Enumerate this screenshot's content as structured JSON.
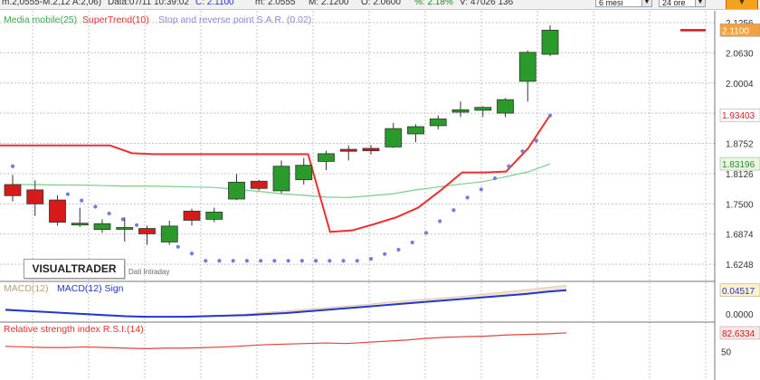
{
  "header": {
    "quote": "m.2,0555-M.2,12 A:2,06)",
    "data_label": "Data:07/11 10:39:02",
    "close_label": "C: 2.1100",
    "min_label": "m: 2.0555",
    "max_label": "M: 2.1200",
    "open_label": "O: 2.0600",
    "pct_label": "%: 2.18%",
    "volume_label": "V: 47026 136",
    "period_select": "6 mesi",
    "interval_select": "24 ore"
  },
  "logo": {
    "text": "VISUALTRADER",
    "subtitle": "Dati Intraday"
  },
  "colors": {
    "up": "#2a9a2a",
    "down": "#d61a1a",
    "supertrend": "#ee3030",
    "sar": "#7a7ad8",
    "ma": "#7ccd8a",
    "macd_line": "#2236d6",
    "macd_area": "#f1e4d2",
    "rsi": "#e84040",
    "grid": "#c4c4c4",
    "tag_price": "#f6a13d"
  },
  "chart_data": [
    {
      "type": "candlestick",
      "legend": [
        "Media mobile(25)",
        "SuperTrend(10)",
        "Stop and reverse point S.A.R. (0.02)"
      ],
      "ylim": [
        1.595,
        2.15
      ],
      "y_ticks": [
        "2.1256",
        "2.0630",
        "2.0004",
        "1.9378",
        "1.8752",
        "1.8126",
        "1.7500",
        "1.6874",
        "1.6248"
      ],
      "y_tick_values": [
        2.1256,
        2.063,
        2.0004,
        1.9378,
        1.8752,
        1.8126,
        1.75,
        1.6874,
        1.6248
      ],
      "candles": [
        {
          "o": 1.79,
          "h": 1.81,
          "l": 1.755,
          "c": 1.767
        },
        {
          "o": 1.779,
          "h": 1.799,
          "l": 1.725,
          "c": 1.75
        },
        {
          "o": 1.758,
          "h": 1.768,
          "l": 1.705,
          "c": 1.712
        },
        {
          "o": 1.707,
          "h": 1.742,
          "l": 1.702,
          "c": 1.71
        },
        {
          "o": 1.697,
          "h": 1.718,
          "l": 1.69,
          "c": 1.709
        },
        {
          "o": 1.699,
          "h": 1.722,
          "l": 1.672,
          "c": 1.701
        },
        {
          "o": 1.699,
          "h": 1.705,
          "l": 1.665,
          "c": 1.688
        },
        {
          "o": 1.671,
          "h": 1.715,
          "l": 1.665,
          "c": 1.704
        },
        {
          "o": 1.735,
          "h": 1.74,
          "l": 1.705,
          "c": 1.716
        },
        {
          "o": 1.718,
          "h": 1.742,
          "l": 1.712,
          "c": 1.733
        },
        {
          "o": 1.76,
          "h": 1.812,
          "l": 1.758,
          "c": 1.795
        },
        {
          "o": 1.797,
          "h": 1.8,
          "l": 1.778,
          "c": 1.782
        },
        {
          "o": 1.777,
          "h": 1.84,
          "l": 1.772,
          "c": 1.828
        },
        {
          "o": 1.8,
          "h": 1.845,
          "l": 1.79,
          "c": 1.83
        },
        {
          "o": 1.838,
          "h": 1.86,
          "l": 1.82,
          "c": 1.854
        },
        {
          "o": 1.863,
          "h": 1.871,
          "l": 1.84,
          "c": 1.859
        },
        {
          "o": 1.865,
          "h": 1.872,
          "l": 1.852,
          "c": 1.86
        },
        {
          "o": 1.868,
          "h": 1.918,
          "l": 1.866,
          "c": 1.906
        },
        {
          "o": 1.895,
          "h": 1.915,
          "l": 1.878,
          "c": 1.91
        },
        {
          "o": 1.912,
          "h": 1.933,
          "l": 1.904,
          "c": 1.926
        },
        {
          "o": 1.94,
          "h": 1.962,
          "l": 1.93,
          "c": 1.945
        },
        {
          "o": 1.944,
          "h": 1.952,
          "l": 1.93,
          "c": 1.95
        },
        {
          "o": 1.938,
          "h": 1.969,
          "l": 1.93,
          "c": 1.966
        },
        {
          "o": 2.004,
          "h": 2.068,
          "l": 1.962,
          "c": 2.064
        },
        {
          "o": 2.06,
          "h": 2.12,
          "l": 2.056,
          "c": 2.11
        }
      ],
      "supertrend": [
        1.871,
        1.871,
        1.871,
        1.871,
        1.871,
        1.871,
        1.855,
        1.853,
        1.853,
        1.853,
        1.853,
        1.853,
        1.853,
        1.853,
        1.853,
        1.692,
        1.695,
        1.708,
        1.722,
        1.742,
        1.777,
        1.815,
        1.815,
        1.817,
        1.865,
        1.934
      ],
      "sar": [
        1.828,
        1.806,
        1.791,
        1.78,
        1.77,
        1.757,
        1.744,
        1.73,
        1.718,
        1.706,
        1.692,
        1.676,
        1.661,
        1.647,
        1.632,
        1.632,
        1.632,
        1.632,
        1.632,
        1.632,
        1.632,
        1.632,
        1.632,
        1.632,
        1.632,
        1.632,
        1.636,
        1.646,
        1.655,
        1.67,
        1.69,
        1.714,
        1.737,
        1.763,
        1.78,
        1.803,
        1.828,
        1.859,
        1.881,
        1.933
      ],
      "sar_visible": [
        true,
        false,
        false,
        false,
        true,
        true,
        true,
        true,
        true,
        true,
        false,
        true,
        true,
        true,
        true,
        true,
        true,
        true,
        true,
        true,
        true,
        true,
        true,
        true,
        true,
        true,
        true,
        true,
        true,
        true,
        true,
        true,
        true,
        true,
        true,
        true,
        true,
        true,
        true,
        true
      ],
      "ma": [
        1.79,
        1.79,
        1.789,
        1.789,
        1.788,
        1.787,
        1.787,
        1.786,
        1.785,
        1.784,
        1.78,
        1.776,
        1.771,
        1.768,
        1.764,
        1.763,
        1.767,
        1.771,
        1.779,
        1.785,
        1.791,
        1.796,
        1.806,
        1.816,
        1.833
      ],
      "last_price_tag": "2.1100",
      "supertrend_tag": "1.93403",
      "ma_tag": "1.83196"
    },
    {
      "type": "line",
      "legend": [
        "MACD(12)",
        "MACD(12) Sign"
      ],
      "ylim": [
        -0.01,
        0.06
      ],
      "y_ticks": [
        "0.0000"
      ],
      "y_tick_values": [
        0.0
      ],
      "macd": [
        0.01,
        0.007,
        0.004,
        0.001,
        -0.001,
        -0.003,
        -0.004,
        -0.005,
        -0.005,
        -0.004,
        -0.003,
        -0.002,
        0.0,
        0.003,
        0.006,
        0.009,
        0.012,
        0.015,
        0.018,
        0.022,
        0.025,
        0.028,
        0.031,
        0.034,
        0.038,
        0.042,
        0.046,
        0.05,
        0.054
      ],
      "signal": [
        0.008,
        0.006,
        0.004,
        0.002,
        0.0,
        -0.002,
        -0.004,
        -0.005,
        -0.005,
        -0.005,
        -0.004,
        -0.003,
        -0.002,
        0.0,
        0.002,
        0.005,
        0.008,
        0.011,
        0.014,
        0.017,
        0.02,
        0.023,
        0.026,
        0.029,
        0.032,
        0.035,
        0.038,
        0.042,
        0.045
      ],
      "tag": "0.04517"
    },
    {
      "type": "line",
      "legend": [
        "Relative strength index R.S.I.(14)"
      ],
      "ylim": [
        0,
        100
      ],
      "y_ticks": [
        "50"
      ],
      "y_tick_values": [
        50
      ],
      "rsi": [
        59,
        58,
        57,
        57,
        58,
        57,
        56,
        55,
        56,
        56,
        57,
        58,
        60,
        62,
        63,
        64,
        65,
        64,
        66,
        68,
        70,
        73,
        75,
        76,
        77,
        79,
        80,
        81,
        82.6
      ],
      "tag": "82.6334"
    }
  ]
}
